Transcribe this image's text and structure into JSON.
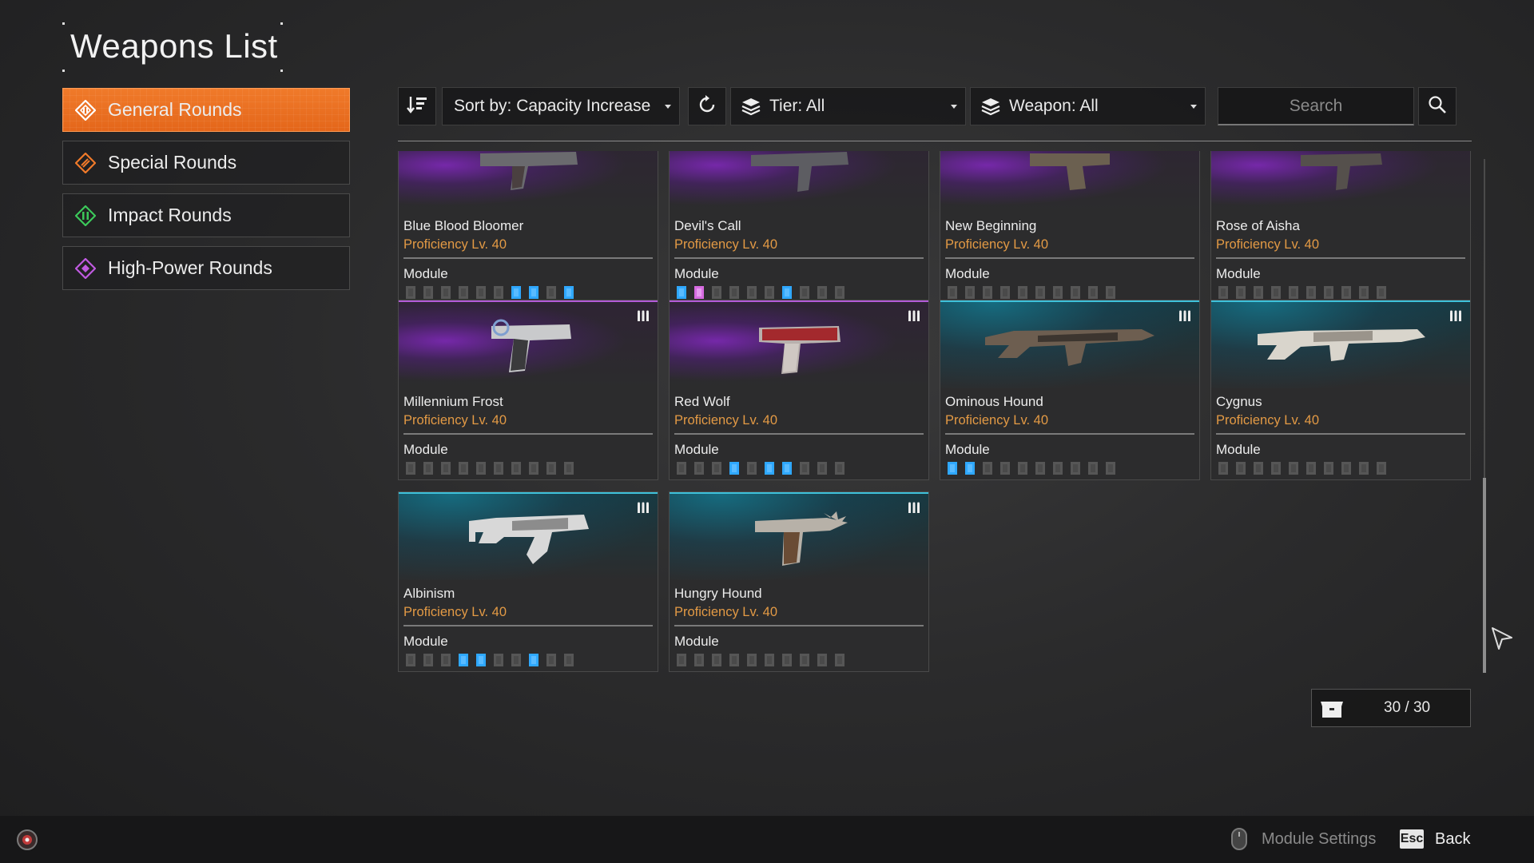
{
  "page": {
    "title": "Weapons List"
  },
  "categories": [
    {
      "label": "General Rounds",
      "active": true,
      "color": "#ffffff",
      "icon": "general-rounds-icon"
    },
    {
      "label": "Special Rounds",
      "active": false,
      "color": "#f07a2a",
      "icon": "special-rounds-icon"
    },
    {
      "label": "Impact Rounds",
      "active": false,
      "color": "#3cc95a",
      "icon": "impact-rounds-icon"
    },
    {
      "label": "High-Power Rounds",
      "active": false,
      "color": "#c05ae0",
      "icon": "high-power-rounds-icon"
    }
  ],
  "toolbar": {
    "sort_label": "Sort by: Capacity Increase",
    "tier_label": "Tier: All",
    "weapon_label": "Weapon: All",
    "search_placeholder": "Search"
  },
  "weapons": [
    {
      "name": "Blue Blood Bloomer",
      "proficiency": "Proficiency Lv. 40",
      "module_label": "Module",
      "theme": "purple",
      "slots": [
        "e",
        "e",
        "e",
        "e",
        "e",
        "e",
        "b",
        "b",
        "e",
        "b"
      ]
    },
    {
      "name": "Devil's Call",
      "proficiency": "Proficiency Lv. 40",
      "module_label": "Module",
      "theme": "purple",
      "slots": [
        "b",
        "p",
        "e",
        "e",
        "e",
        "e",
        "b",
        "e",
        "e",
        "e"
      ]
    },
    {
      "name": "New Beginning",
      "proficiency": "Proficiency Lv. 40",
      "module_label": "Module",
      "theme": "purple",
      "slots": [
        "e",
        "e",
        "e",
        "e",
        "e",
        "e",
        "e",
        "e",
        "e",
        "e"
      ]
    },
    {
      "name": "Rose of Aisha",
      "proficiency": "Proficiency Lv. 40",
      "module_label": "Module",
      "theme": "purple",
      "slots": [
        "e",
        "e",
        "e",
        "e",
        "e",
        "e",
        "e",
        "e",
        "e",
        "e"
      ]
    },
    {
      "name": "Millennium Frost",
      "proficiency": "Proficiency Lv. 40",
      "module_label": "Module",
      "theme": "purple",
      "slots": [
        "e",
        "e",
        "e",
        "e",
        "e",
        "e",
        "e",
        "e",
        "e",
        "e"
      ]
    },
    {
      "name": "Red Wolf",
      "proficiency": "Proficiency Lv. 40",
      "module_label": "Module",
      "theme": "purple",
      "slots": [
        "e",
        "e",
        "e",
        "b",
        "e",
        "b",
        "b",
        "e",
        "e",
        "e"
      ]
    },
    {
      "name": "Ominous Hound",
      "proficiency": "Proficiency Lv. 40",
      "module_label": "Module",
      "theme": "blue",
      "slots": [
        "b",
        "b",
        "e",
        "e",
        "e",
        "e",
        "e",
        "e",
        "e",
        "e"
      ]
    },
    {
      "name": "Cygnus",
      "proficiency": "Proficiency Lv. 40",
      "module_label": "Module",
      "theme": "blue",
      "slots": [
        "e",
        "e",
        "e",
        "e",
        "e",
        "e",
        "e",
        "e",
        "e",
        "e"
      ]
    },
    {
      "name": "Albinism",
      "proficiency": "Proficiency Lv. 40",
      "module_label": "Module",
      "theme": "blue",
      "slots": [
        "e",
        "e",
        "e",
        "b",
        "b",
        "e",
        "e",
        "b",
        "e",
        "e"
      ]
    },
    {
      "name": "Hungry Hound",
      "proficiency": "Proficiency Lv. 40",
      "module_label": "Module",
      "theme": "blue",
      "slots": [
        "e",
        "e",
        "e",
        "e",
        "e",
        "e",
        "e",
        "e",
        "e",
        "e"
      ]
    }
  ],
  "inventory": {
    "count": "30 / 30"
  },
  "footer": {
    "module_settings": "Module Settings",
    "esc_key": "Esc",
    "back_label": "Back"
  },
  "colors": {
    "accent": "#e4661a",
    "proficiency": "#e39a45",
    "slot_blue": "#2fa8ff",
    "slot_pink": "#d66be0"
  }
}
